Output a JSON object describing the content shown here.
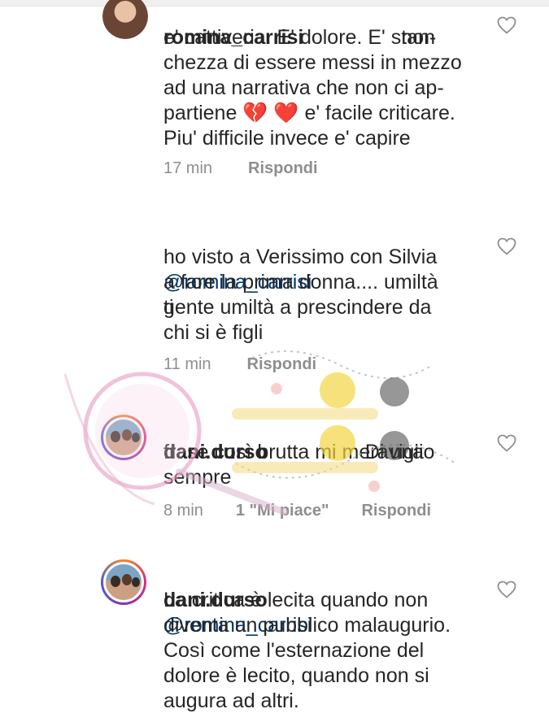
{
  "comments": [
    {
      "username": "romina_carrisi",
      "text_after_redaction": "non",
      "body": "e' cattiveria. E' dolore. E' stan-\nchezza di essere messi in mezzo\nad una narrativa che non ci ap-\npartiene 💔 ❤️ e' facile criticare.\nPiu' difficile invece e' capire",
      "time": "17 min",
      "reply_label": "Rispondi"
    },
    {
      "mention": "@romina_carrisi",
      "body_first": "ti",
      "body": "ho visto a Verissimo con Silvia\na fare la prima donna.... umiltà\ngente umiltà a prescindere da\nchi si è figli",
      "time": "11 min",
      "reply_label": "Rispondi"
    },
    {
      "username": "dani.durso",
      "body_first": "Di una",
      "body": "frase così brutta mi meraviglio\nsempre",
      "time": "8 min",
      "likes_label": "1 \"Mi piace\"",
      "reply_label": "Rispondi"
    },
    {
      "username": "dani.durso",
      "mention": "@romina_carrisi",
      "body": "La critica è lecita quando non\ndiventa un pubblico malaugurio.\nCosì come l'esternazione del\ndolore è lecito, quando non si\naugura ad altri."
    }
  ],
  "icons": {
    "like": "heart-outline-icon"
  },
  "colors": {
    "text": "#262626",
    "muted": "#8e8e8e",
    "mention": "#00376b"
  }
}
